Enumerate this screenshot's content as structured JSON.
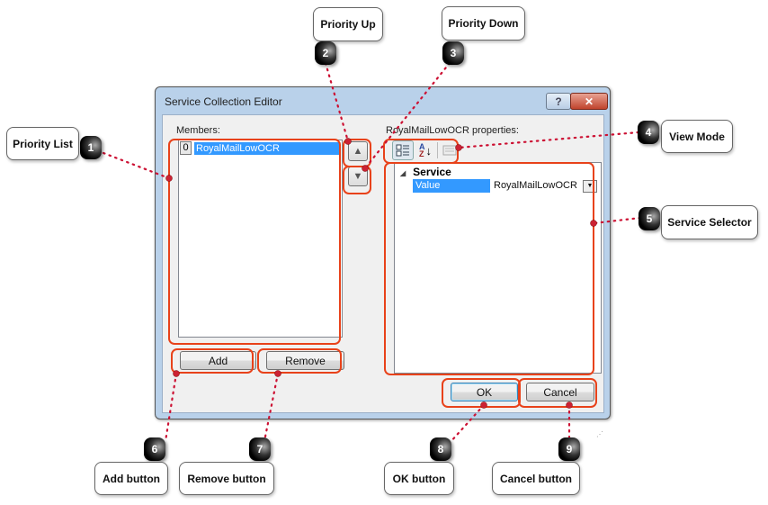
{
  "dialog": {
    "title": "Service Collection Editor",
    "help_icon": "question-icon",
    "close_icon": "close-icon",
    "members_label": "Members:",
    "members": [
      {
        "index": "0",
        "name": "RoyalMailLowOCR",
        "selected": true
      }
    ],
    "priority_up_icon": "arrow-up-icon",
    "priority_down_icon": "arrow-down-icon",
    "properties_label": "RoyalMailLowOCR properties:",
    "toolbar": {
      "categorized_icon": "categorized-icon",
      "alphabetical_icon": "sort-az-icon",
      "property_pages_icon": "property-pages-icon"
    },
    "property_grid": {
      "category": "Service",
      "rows": [
        {
          "name": "Value",
          "value": "RoyalMailLowOCR"
        }
      ]
    },
    "add_label": "Add",
    "remove_label": "Remove",
    "ok_label": "OK",
    "cancel_label": "Cancel"
  },
  "callouts": [
    {
      "number": "1",
      "label": "Priority List"
    },
    {
      "number": "2",
      "label": "Priority Up"
    },
    {
      "number": "3",
      "label": "Priority Down"
    },
    {
      "number": "4",
      "label": "View Mode"
    },
    {
      "number": "5",
      "label": "Service Selector"
    },
    {
      "number": "6",
      "label": "Add button"
    },
    {
      "number": "7",
      "label": "Remove button"
    },
    {
      "number": "8",
      "label": "OK button"
    },
    {
      "number": "9",
      "label": "Cancel button"
    }
  ],
  "colors": {
    "highlight": "#e8421a",
    "connector": "#cc1133",
    "selection": "#3399ff"
  }
}
